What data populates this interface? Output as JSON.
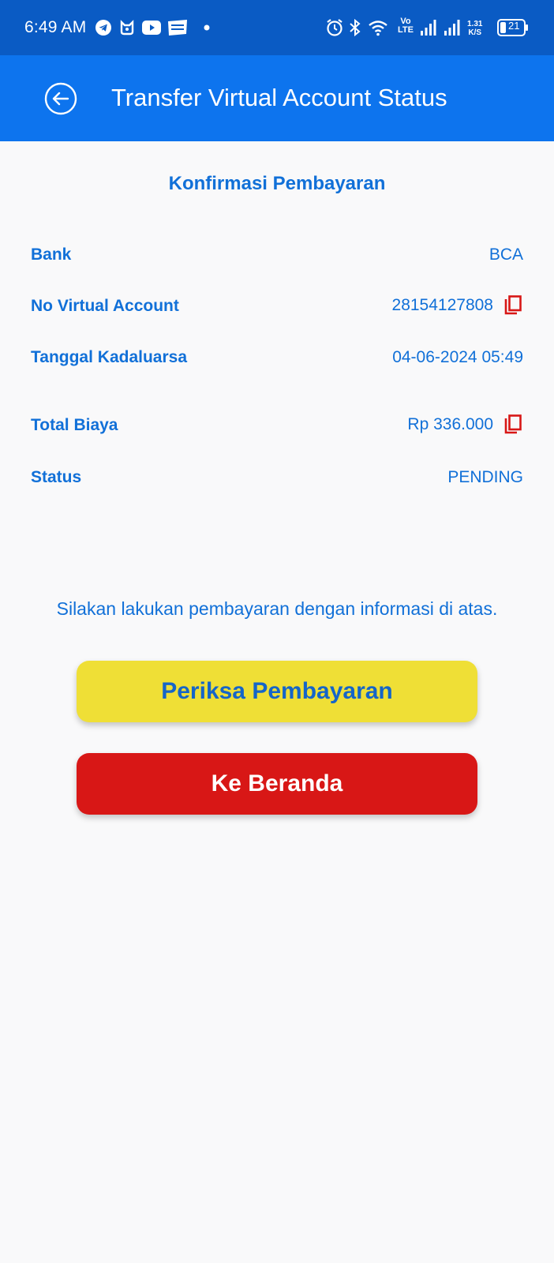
{
  "status_bar": {
    "time": "6:49 AM",
    "battery": "21",
    "speed_value": "1.31",
    "speed_unit": "K/S",
    "volte": "Vo",
    "lte": "LTE"
  },
  "app_bar": {
    "title": "Transfer Virtual Account Status",
    "back_icon": "back-arrow-circle-icon"
  },
  "confirmation": {
    "title": "Konfirmasi Pembayaran",
    "rows": [
      {
        "label": "Bank",
        "value": "BCA"
      },
      {
        "label": "No Virtual Account",
        "value": "28154127808",
        "copy_icon": "copy-icon"
      },
      {
        "label": "Tanggal Kadaluarsa",
        "value": "04-06-2024 05:49"
      },
      {
        "label": "Total Biaya",
        "value": "Rp 336.000",
        "copy_icon": "copy-icon"
      },
      {
        "label": "Status",
        "value": "PENDING"
      }
    ]
  },
  "info": "Silakan lakukan pembayaran dengan informasi di atas.",
  "buttons": {
    "check_payment": "Periksa Pembayaran",
    "home": "Ke Beranda"
  },
  "colors": {
    "status_bar": "#0a5bc4",
    "app_bar": "#0d74ee",
    "text_accent": "#1170d8",
    "check_button": "#efdf36",
    "home_button": "#d81716",
    "copy_icon": "#d81716"
  }
}
